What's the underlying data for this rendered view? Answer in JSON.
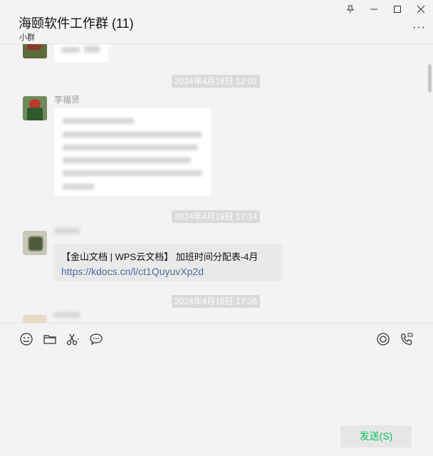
{
  "header": {
    "title": "海颐软件工作群 (11)",
    "subtitle": "小群",
    "window_buttons": {
      "pin": "pin-icon",
      "minimize": "minimize-icon",
      "maximize": "maximize-icon",
      "close": "close-icon"
    },
    "more_label": "···"
  },
  "messages": {
    "time1": "2024年4月19日 12:01",
    "sender1": "李福贤",
    "time2": "2024年4月19日 17:14",
    "link_title": "【金山文档 | WPS云文档】 加班时间分配表-4月",
    "link_url": "https://kdocs.cn/l/ct1QuyuvXp2d",
    "time3": "2024年4月19日 17:36"
  },
  "toolbar": {
    "icons": [
      "emoji-icon",
      "folder-icon",
      "scissors-icon",
      "chat-bubble-icon",
      "live-icon",
      "call-icon"
    ]
  },
  "composer": {
    "send_label": "发送(S)"
  },
  "colors": {
    "background": "#f3f3f3",
    "bubble": "#ffffff",
    "link": "#4a6c9e",
    "send_text": "#07c160"
  }
}
